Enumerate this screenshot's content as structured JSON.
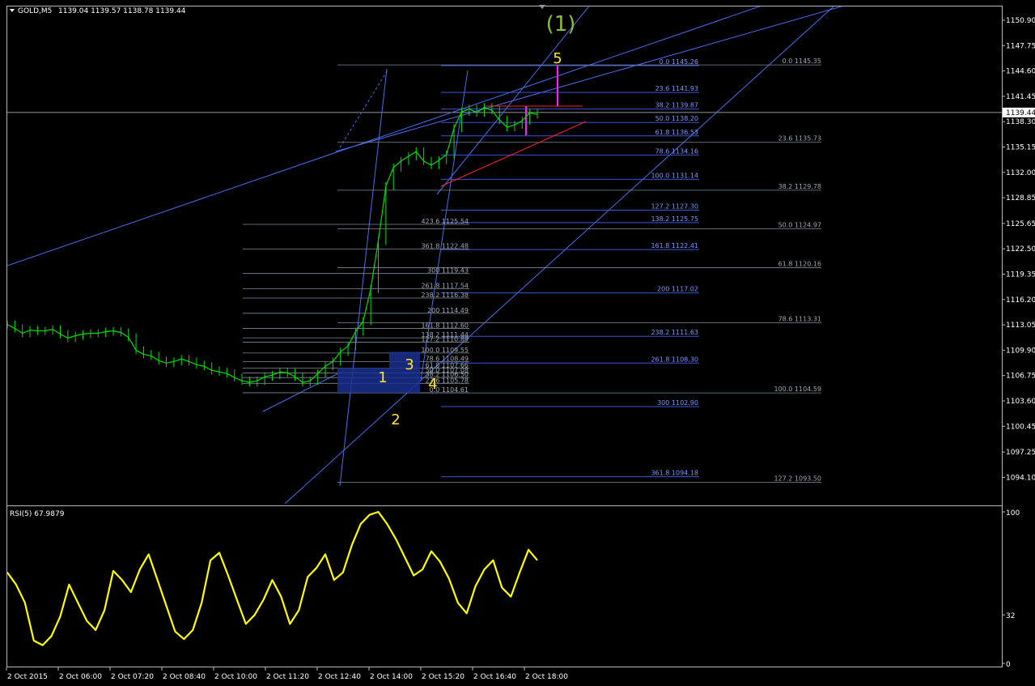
{
  "header": {
    "symbol": "GOLD,M5",
    "ohlc": "1139.04 1139.57 1138.78 1139.44",
    "menu_icon": "triangle-down-icon"
  },
  "colors": {
    "background": "#000000",
    "candle": "#00e000",
    "channel": "#4a6cf0",
    "fib_retracement": "#7a8a9a",
    "fib_extension": "#3a55d8",
    "rsi": "#ffff00",
    "wave_count": "#ffe52a",
    "wave_degree": "#8abd3a",
    "wave_marker": "#ff20ff",
    "trend_line": "#ff2020",
    "price_line": "#c0c8d0",
    "box": "#1a2f8f"
  },
  "price_axis": {
    "ticks": [
      "1150.90",
      "1147.75",
      "1144.60",
      "1141.45",
      "1138.30",
      "1135.15",
      "1132.00",
      "1128.85",
      "1125.65",
      "1122.50",
      "1119.35",
      "1116.20",
      "1113.05",
      "1109.90",
      "1106.75",
      "1103.60",
      "1100.45",
      "1097.25",
      "1094.10"
    ],
    "current_price": "1139.44"
  },
  "time_axis": {
    "ticks": [
      "2 Oct 2015",
      "2 Oct 06:00",
      "2 Oct 07:20",
      "2 Oct 08:40",
      "2 Oct 10:00",
      "2 Oct 11:20",
      "2 Oct 12:40",
      "2 Oct 14:00",
      "2 Oct 15:20",
      "2 Oct 16:40",
      "2 Oct 18:00"
    ]
  },
  "wave_labels": {
    "degree": "(1)",
    "counts": [
      "1",
      "2",
      "3",
      "4",
      "5"
    ]
  },
  "fib_right": [
    {
      "level": "0.0",
      "price": "1145.26"
    },
    {
      "level": "23.6",
      "price": "1141.93"
    },
    {
      "level": "38.2",
      "price": "1139.87"
    },
    {
      "level": "50.0",
      "price": "1138.20"
    },
    {
      "level": "61.8",
      "price": "1136.53"
    },
    {
      "level": "78.6",
      "price": "1134.16"
    },
    {
      "level": "100.0",
      "price": "1131.14"
    },
    {
      "level": "127.2",
      "price": "1127.30"
    },
    {
      "level": "138.2",
      "price": "1125.75"
    },
    {
      "level": "161.8",
      "price": "1122.41"
    },
    {
      "level": "200",
      "price": "1117.02"
    },
    {
      "level": "238.2",
      "price": "1111.63"
    },
    {
      "level": "261.8",
      "price": "1108.30"
    },
    {
      "level": "300",
      "price": "1102.90"
    },
    {
      "level": "361.8",
      "price": "1094.18"
    }
  ],
  "fib_far_right": [
    {
      "level": "0.0",
      "price": "1145.35"
    },
    {
      "level": "23.6",
      "price": "1135.73"
    },
    {
      "level": "38.2",
      "price": "1129.78"
    },
    {
      "level": "50.0",
      "price": "1124.97"
    },
    {
      "level": "61.8",
      "price": "1120.16"
    },
    {
      "level": "78.6",
      "price": "1113.31"
    },
    {
      "level": "100.0",
      "price": "1104.59"
    },
    {
      "level": "127.2",
      "price": "1093.50"
    }
  ],
  "fib_left": [
    {
      "level": "423.6",
      "price": "1125.54"
    },
    {
      "level": "361.8",
      "price": "1122.48"
    },
    {
      "level": "300",
      "price": "1119.43"
    },
    {
      "level": "261.8",
      "price": "1117.54"
    },
    {
      "level": "238.2",
      "price": "1116.38"
    },
    {
      "level": "200",
      "price": "1114.49"
    },
    {
      "level": "161.8",
      "price": "1112.60"
    },
    {
      "level": "138.2",
      "price": "1111.44"
    },
    {
      "level": "127.2",
      "price": "1110.89"
    },
    {
      "level": "100.0",
      "price": "1109.55"
    },
    {
      "level": "78.6",
      "price": "1108.49"
    },
    {
      "level": "61.8",
      "price": "1107.66"
    },
    {
      "level": "50.0",
      "price": "1107.08"
    },
    {
      "level": "38.2",
      "price": "1106.50"
    },
    {
      "level": "23.6",
      "price": "1105.78"
    },
    {
      "level": "0.0",
      "price": "1104.61"
    }
  ],
  "chart_data": [
    {
      "type": "candlestick",
      "title": "GOLD,M5",
      "ylim": [
        1092.6,
        1152.5
      ],
      "x": [
        "2 Oct 2015",
        "2 Oct 06:00",
        "2 Oct 07:20",
        "2 Oct 08:40",
        "2 Oct 10:00",
        "2 Oct 11:20",
        "2 Oct 12:40",
        "2 Oct 14:00",
        "2 Oct 15:20",
        "2 Oct 16:40",
        "2 Oct 18:00"
      ],
      "series": [
        {
          "values": [
            1113.1,
            1112.6,
            1112.0,
            1112.4,
            1112.3,
            1112.3,
            1112.5,
            1111.9,
            1111.4,
            1111.7,
            1111.9,
            1112.0,
            1112.0,
            1112.2,
            1112.3,
            1112.1,
            1111.5,
            1109.9,
            1109.4,
            1109.2,
            1108.6,
            1108.3,
            1108.5,
            1108.8,
            1108.5,
            1108.1,
            1107.9,
            1107.4,
            1107.2,
            1107.0,
            1106.5,
            1106.1,
            1105.9,
            1106.1,
            1106.6,
            1106.8,
            1107.2,
            1107.1,
            1106.6,
            1105.9,
            1106.1,
            1107.0,
            1107.9,
            1108.5,
            1109.7,
            1110.4,
            1112.2,
            1113.5,
            1117.5,
            1123.5,
            1130.3,
            1132.6,
            1133.4,
            1134.0,
            1134.6,
            1133.4,
            1132.9,
            1133.5,
            1134.2,
            1137.5,
            1139.5,
            1139.9,
            1139.4,
            1140.1,
            1139.7,
            1138.5,
            1137.6,
            1137.9,
            1138.4,
            1139.4,
            1139.2
          ]
        }
      ]
    },
    {
      "type": "line",
      "title": "RSI(5) 67.9879",
      "ylim": [
        0,
        100
      ],
      "yticks": [
        "100",
        "32",
        "0"
      ],
      "series": [
        {
          "name": "RSI(5)",
          "values": [
            60,
            52,
            40,
            15,
            12,
            18,
            31,
            52,
            40,
            28,
            22,
            35,
            61,
            55,
            47,
            62,
            72,
            55,
            38,
            21,
            16,
            22,
            40,
            68,
            73,
            58,
            42,
            26,
            32,
            42,
            55,
            44,
            26,
            35,
            57,
            63,
            72,
            55,
            60,
            78,
            92,
            98,
            100,
            92,
            82,
            70,
            58,
            62,
            74,
            67,
            56,
            40,
            33,
            51,
            62,
            68,
            50,
            44,
            60,
            75,
            68
          ]
        }
      ]
    }
  ]
}
